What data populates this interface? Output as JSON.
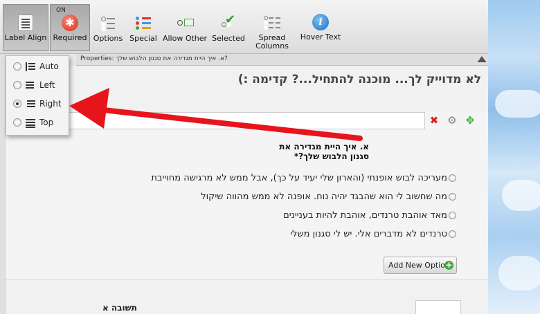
{
  "toolbar": {
    "label_align": "Label Align",
    "required_on": "ON",
    "required": "Required",
    "options": "Options",
    "special": "Special",
    "allow_other": "Allow Other",
    "selected": "Selected",
    "spread_columns_1": "Spread",
    "spread_columns_2": "Columns",
    "hover_text": "Hover Text"
  },
  "align_menu": {
    "items": [
      {
        "label": "Auto",
        "icon": "align-auto-icon",
        "checked": false
      },
      {
        "label": "Left",
        "icon": "align-left-icon",
        "checked": false
      },
      {
        "label": "Right",
        "icon": "align-right-icon",
        "checked": true
      },
      {
        "label": "Top",
        "icon": "align-top-icon",
        "checked": false
      }
    ]
  },
  "properties_bar": {
    "text": "Properties: א. איך היית מגדירה את סגנון הלבוש שלך?"
  },
  "form": {
    "title": "לא מדוייק לך... מוכנה להתחיל...? קדימה :)",
    "question_line1": "א. איך היית מגדירה את",
    "question_line2": "סגנון הלבוש שלך?*",
    "options": [
      "מעריכה לבוש אופנתי (והארון שלי יעיד על כך), אבל ממש לא מרגישה מחוייבת",
      "מה שחשוב לי הוא שהבגד יהיה נוח. אופנה לא ממש מהווה שיקול",
      "מאד אוהבת טרנדים, אוהבת להיות בעניינים",
      "טרנדים לא מדברים אלי. יש לי סגנון משלי"
    ],
    "add_option": "Add New Option",
    "next_label": "תשובה א"
  },
  "colors": {
    "accent_arrow": "#e8141c",
    "required_icon": "#d42b1c",
    "hover_icon": "#1a6fc0",
    "add_plus": "#43a843"
  }
}
